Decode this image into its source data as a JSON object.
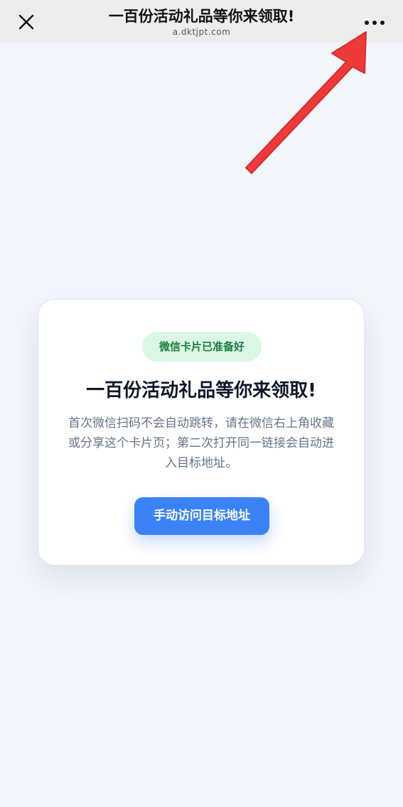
{
  "navbar": {
    "title": "一百份活动礼品等你来领取!",
    "url": "a.dktjpt.com",
    "close_icon": "close-icon",
    "more_icon": "more-dots-icon"
  },
  "overlay": {
    "arrow_icon": "red-arrow-icon",
    "arrow_color": "#f03a3a"
  },
  "card": {
    "badge": "微信卡片已准备好",
    "title": "一百份活动礼品等你来领取!",
    "description": "首次微信扫码不会自动跳转，请在微信右上角收藏或分享这个卡片页；第二次打开同一链接会自动进入目标地址。",
    "button_label": "手动访问目标地址"
  },
  "colors": {
    "background": "#f3f6fb",
    "navbar": "#ededed",
    "badge_bg": "#dcf7e5",
    "badge_text": "#15803d",
    "button": "#3b82f6",
    "title": "#0f172a",
    "description": "#64748b"
  }
}
